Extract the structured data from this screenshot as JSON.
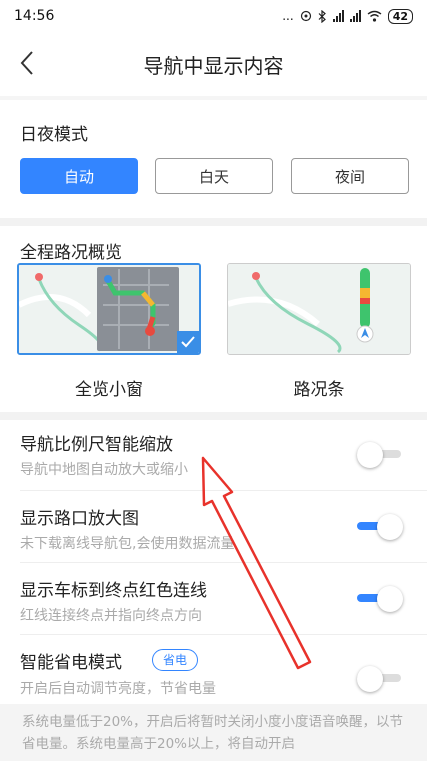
{
  "status_bar": {
    "time": "14:56",
    "dots": "...",
    "battery": "42"
  },
  "header": {
    "title": "导航中显示内容"
  },
  "day_night": {
    "title": "日夜模式",
    "options": [
      "自动",
      "白天",
      "夜间"
    ],
    "selected": "自动"
  },
  "overview": {
    "title": "全程路况概览",
    "options": [
      "全览小窗",
      "路况条"
    ],
    "selected": "全览小窗"
  },
  "settings": [
    {
      "title": "导航比例尺智能缩放",
      "desc": "导航中地图自动放大或缩小",
      "enabled": false
    },
    {
      "title": "显示路口放大图",
      "desc": "未下载离线导航包,会使用数据流量",
      "enabled": true
    },
    {
      "title": "显示车标到终点红色连线",
      "desc": "红线连接终点并指向终点方向",
      "enabled": true
    },
    {
      "title": "智能省电模式",
      "badge": "省电",
      "desc": "开启后自动调节亮度，节省电量",
      "enabled": false
    }
  ],
  "footer_note": "系统电量低于20%，开启后将暂时关闭小度小度语音唤醒，以节省电量。系统电量高于20%以上，将自动开启",
  "colors": {
    "accent": "#3385ff",
    "annotation": "#e8322b"
  }
}
